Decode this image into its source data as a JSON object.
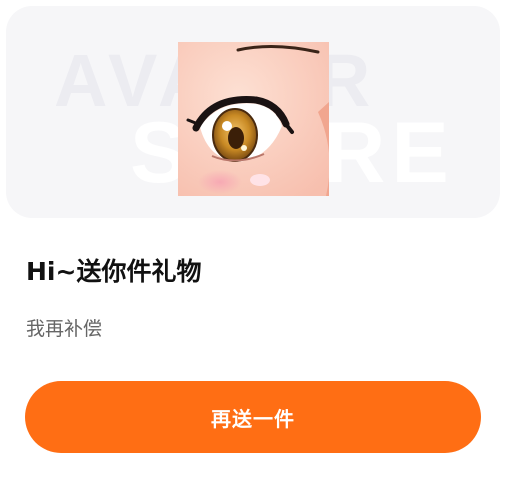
{
  "hero": {
    "watermark_line1": "AVATAR",
    "watermark_line2": "STORE",
    "image_icon": "anime-eye-gift-image"
  },
  "dialog": {
    "title": "Hi~送你件礼物",
    "subtitle": "我再补偿",
    "button_label": "再送一件"
  },
  "colors": {
    "accent": "#ff6e14",
    "hero_bg": "#f6f6f8",
    "title": "#111111",
    "subtitle": "#666666"
  }
}
